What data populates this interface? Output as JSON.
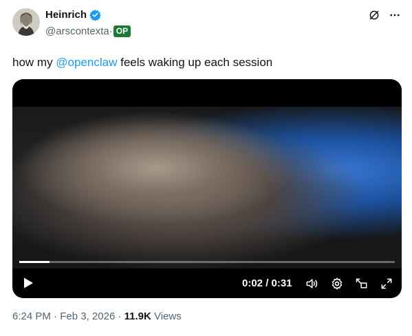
{
  "author": {
    "name": "Heinrich",
    "handle": "@arscontexta",
    "handle_sep": "·",
    "badge": "OP"
  },
  "icons": {
    "verified": "verified-badge-icon",
    "grok": "grok-icon",
    "more": "more-icon"
  },
  "tweet": {
    "text_before": "how my ",
    "mention": "@openclaw",
    "text_after": " feels waking up each session"
  },
  "video": {
    "time": "0:02 / 0:31",
    "progress": 0.08
  },
  "meta": {
    "time": "6:24 PM",
    "sep1": " · ",
    "date": "Feb 3, 2026",
    "sep2": " · ",
    "views_count": "11.9K",
    "views_label": " Views"
  },
  "colors": {
    "accent": "#1d9bf0",
    "badge": "#1e7a33",
    "muted": "#536471"
  }
}
